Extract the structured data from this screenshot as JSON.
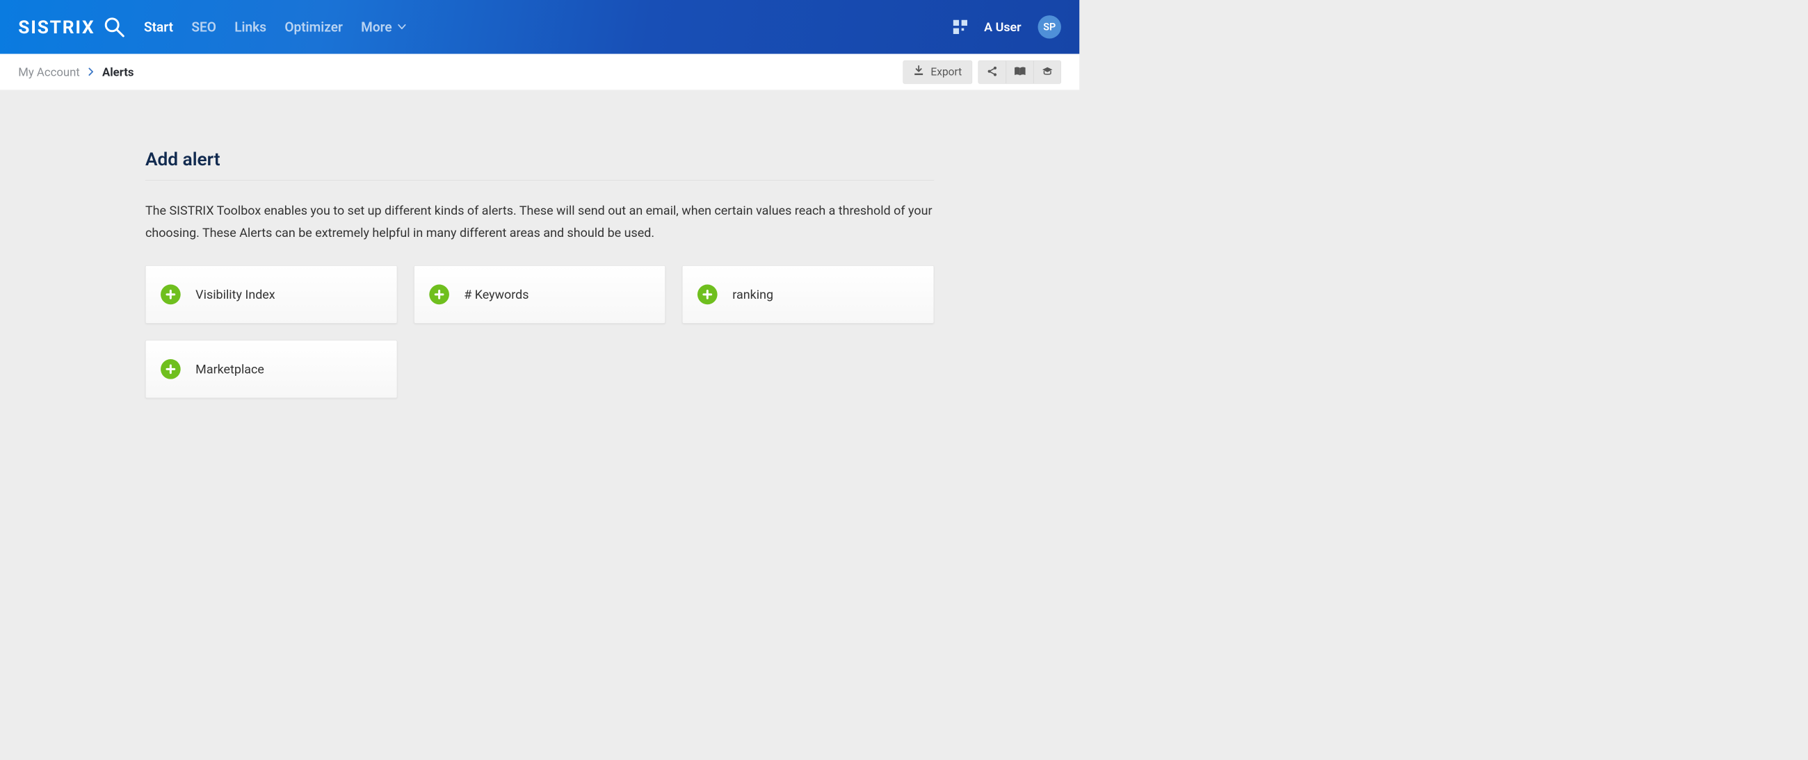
{
  "brand": {
    "name": "SISTRIX"
  },
  "nav": {
    "items": [
      {
        "label": "Start",
        "active": true
      },
      {
        "label": "SEO",
        "active": false
      },
      {
        "label": "Links",
        "active": false
      },
      {
        "label": "Optimizer",
        "active": false
      },
      {
        "label": "More",
        "active": false,
        "dropdown": true
      }
    ]
  },
  "user": {
    "name": "A User",
    "initials": "SP"
  },
  "breadcrumb": {
    "root": "My Account",
    "current": "Alerts"
  },
  "actions": {
    "export_label": "Export"
  },
  "page": {
    "title": "Add alert",
    "description": "The SISTRIX Toolbox enables you to set up different kinds of alerts. These will send out an email, when certain values reach a threshold of your choosing. These Alerts can be extremely helpful in many different areas and should be used."
  },
  "alert_types": [
    {
      "label": "Visibility Index"
    },
    {
      "label": "# Keywords"
    },
    {
      "label": "ranking"
    },
    {
      "label": "Marketplace"
    }
  ]
}
